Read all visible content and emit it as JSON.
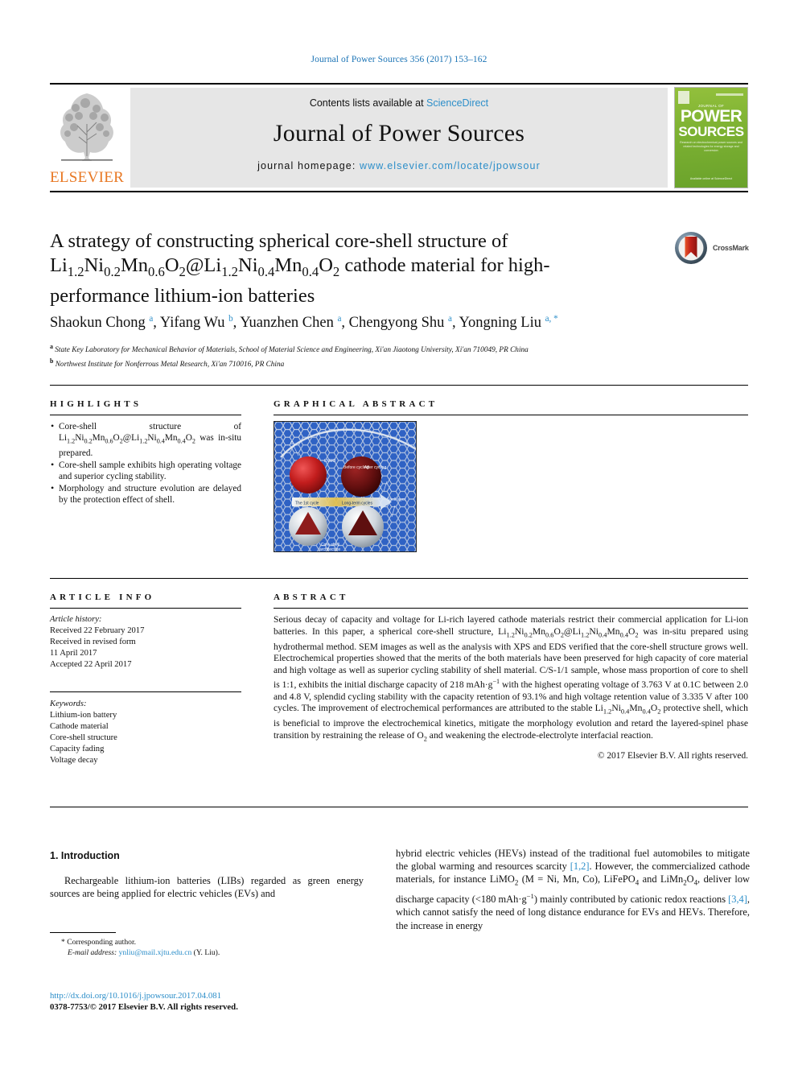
{
  "running_head": "Journal of Power Sources 356 (2017) 153–162",
  "masthead": {
    "contents_prefix": "Contents lists available at",
    "sciencedirect": "ScienceDirect",
    "journal_title": "Journal of Power Sources",
    "homepage_prefix": "journal homepage:",
    "homepage_url": "www.elsevier.com/locate/jpowsour",
    "publisher": "ELSEVIER",
    "cover": {
      "eyebrow": "JOURNAL OF",
      "line1": "POWER",
      "line2": "SOURCES",
      "subtitle": "Research on electrochemical power sources and\nrelated technologies for energy storage and conversion",
      "footer": "Available online at\nScienceDirect"
    }
  },
  "article": {
    "title_line1": "A strategy of constructing spherical core-shell structure of",
    "title_formula": "Li",
    "title_line2_plain": "cathode material for high-",
    "title_line3": "performance lithium-ion batteries",
    "crossmark_label": "CrossMark",
    "authors": [
      {
        "name": "Shaokun Chong",
        "mark": "a"
      },
      {
        "name": "Yifang Wu",
        "mark": "b"
      },
      {
        "name": "Yuanzhen Chen",
        "mark": "a"
      },
      {
        "name": "Chengyong Shu",
        "mark": "a"
      },
      {
        "name": "Yongning Liu",
        "mark": "a, *"
      }
    ],
    "affiliations": [
      {
        "mark": "a",
        "text": "State Key Laboratory for Mechanical Behavior of Materials, School of Material Science and Engineering, Xi'an Jiaotong University, Xi'an 710049, PR China"
      },
      {
        "mark": "b",
        "text": "Northwest Institute for Nonferrous Metal Research, Xi'an 710016, PR China"
      }
    ]
  },
  "highlights": {
    "heading": "HIGHLIGHTS",
    "items": [
      "Core-shell structure of Li1.2Ni0.2Mn0.6O2@Li1.2Ni0.4Mn0.4O2 was in-situ prepared.",
      "Core-shell sample exhibits high operating voltage and superior cycling stability.",
      "Morphology and structure evolution are delayed by the protection effect of shell."
    ]
  },
  "graphical_abstract": {
    "heading": "GRAPHICAL ABSTRACT",
    "image_labels": [
      "O2",
      "LNMO",
      "Before cycling",
      "After cycling",
      "The 1st cycle",
      "Long-term cycles",
      "Shell layer",
      "Core-shell architecture"
    ]
  },
  "article_info": {
    "heading": "ARTICLE INFO",
    "history_label": "Article history:",
    "history": [
      "Received 22 February 2017",
      "Received in revised form",
      "11 April 2017",
      "Accepted 22 April 2017"
    ],
    "keywords_label": "Keywords:",
    "keywords": [
      "Lithium-ion battery",
      "Cathode material",
      "Core-shell structure",
      "Capacity fading",
      "Voltage decay"
    ]
  },
  "abstract": {
    "heading": "ABSTRACT",
    "text": "Serious decay of capacity and voltage for Li-rich layered cathode materials restrict their commercial application for Li-ion batteries. In this paper, a spherical core-shell structure, Li1.2Ni0.2Mn0.6O2@Li1.2Ni0.4Mn0.4O2 was in-situ prepared using hydrothermal method. SEM images as well as the analysis with XPS and EDS verified that the core-shell structure grows well. Electrochemical properties showed that the merits of the both materials have been preserved for high capacity of core material and high voltage as well as superior cycling stability of shell material. C/S-1/1 sample, whose mass proportion of core to shell is 1:1, exhibits the initial discharge capacity of 218 mAh·g−1 with the highest operating voltage of 3.763 V at 0.1C between 2.0 and 4.8 V, splendid cycling stability with the capacity retention of 93.1% and high voltage retention value of 3.335 V after 100 cycles. The improvement of electrochemical performances are attributed to the stable Li1.2Ni0.4Mn0.4O2 protective shell, which is beneficial to improve the electrochemical kinetics, mitigate the morphology evolution and retard the layered-spinel phase transition by restraining the release of O2 and weakening the electrode-electrolyte interfacial reaction.",
    "copyright": "© 2017 Elsevier B.V. All rights reserved."
  },
  "introduction": {
    "number": "1.",
    "heading": "Introduction",
    "left_text": "Rechargeable lithium-ion batteries (LIBs) regarded as green energy sources are being applied for electric vehicles (EVs) and",
    "right_text": "hybrid electric vehicles (HEVs) instead of the traditional fuel automobiles to mitigate the global warming and resources scarcity [1,2]. However, the commercialized cathode materials, for instance LiMO2 (M = Ni, Mn, Co), LiFePO4 and LiMn2O4, deliver low discharge capacity (<180 mAh·g−1) mainly contributed by cationic redox reactions [3,4], which cannot satisfy the need of long distance endurance for EVs and HEVs. Therefore, the increase in energy"
  },
  "footer": {
    "corresponding_marker": "*",
    "corresponding_label": "Corresponding author.",
    "email_label": "E-mail address:",
    "email": "ynliu@mail.xjtu.edu.cn",
    "email_owner": "(Y. Liu).",
    "doi": "http://dx.doi.org/10.1016/j.jpowsour.2017.04.081",
    "issn_line": "0378-7753/© 2017 Elsevier B.V. All rights reserved."
  },
  "colors": {
    "link_blue": "#2c8ec9",
    "elsevier_orange": "#E87722",
    "cover_green": "#7cb132",
    "masthead_gray": "#e6e6e6"
  }
}
